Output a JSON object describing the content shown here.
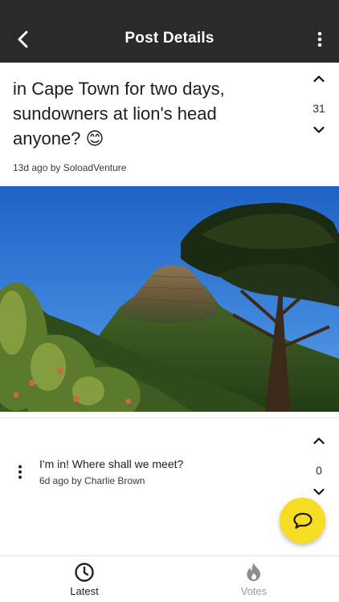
{
  "header": {
    "title": "Post Details",
    "back_icon": "chevron-left-icon",
    "more_icon": "more-vertical-icon"
  },
  "post": {
    "text": "in Cape Town for two days, sundowners at lion's head anyone? 😊",
    "meta": "13d ago by SoloadVenture",
    "votes": "31"
  },
  "photo": {
    "subject": "mountain-landscape-image"
  },
  "comment": {
    "text": "I'm in! Where shall we meet?",
    "meta": "6d ago by Charlie Brown",
    "votes": "0"
  },
  "fab": {
    "icon": "chat-bubble-icon",
    "color": "#f7dc24"
  },
  "tabs": [
    {
      "label": "Latest",
      "icon": "clock-icon",
      "active": true
    },
    {
      "label": "Votes",
      "icon": "flame-icon",
      "active": false
    }
  ],
  "colors": {
    "header_bg": "#2a2a2a",
    "accent": "#f7dc24"
  }
}
